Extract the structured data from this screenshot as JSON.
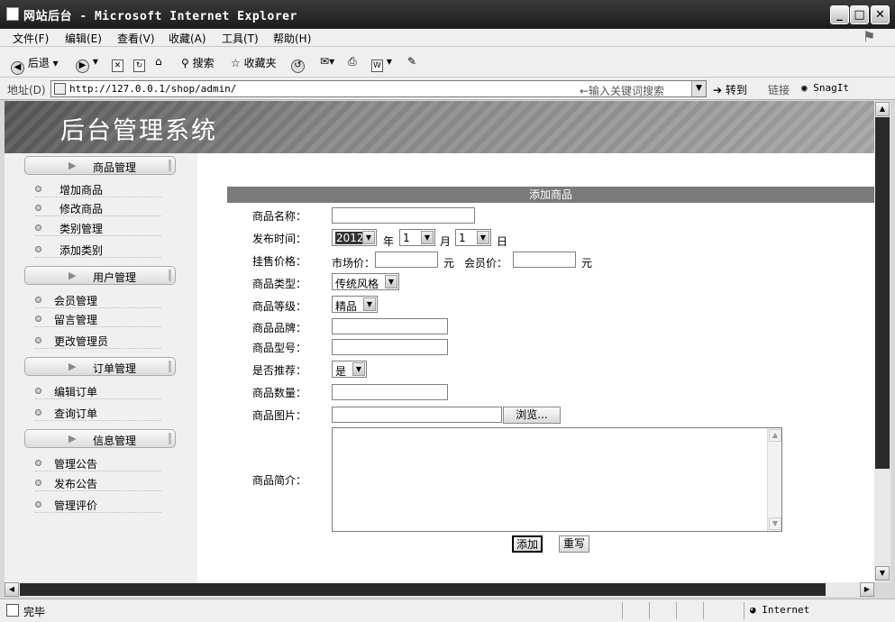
{
  "window": {
    "title": "网站后台 - Microsoft Internet Explorer"
  },
  "menu": [
    "文件(F)",
    "编辑(E)",
    "查看(V)",
    "收藏(A)",
    "工具(T)",
    "帮助(H)"
  ],
  "toolbar": {
    "back": "后退",
    "search": "搜索",
    "favorites": "收藏夹"
  },
  "address": {
    "label": "地址(D)",
    "url": "http://127.0.0.1/shop/admin/",
    "search_hint": "←输入关键词搜索",
    "go": "转到",
    "links": "链接",
    "snagit": "SnagIt"
  },
  "banner": {
    "title": "后台管理系统"
  },
  "sidebar": {
    "sections": [
      {
        "title": "商品管理",
        "items": [
          "增加商品",
          "修改商品",
          "类别管理",
          "添加类别"
        ]
      },
      {
        "title": "用户管理",
        "items": [
          "会员管理",
          "留言管理",
          "更改管理员"
        ]
      },
      {
        "title": "订单管理",
        "items": [
          "编辑订单",
          "查询订单"
        ]
      },
      {
        "title": "信息管理",
        "items": [
          "管理公告",
          "发布公告",
          "管理评价"
        ]
      }
    ]
  },
  "form": {
    "header": "添加商品",
    "labels": {
      "name": "商品名称：",
      "date": "发布时间：",
      "price": "挂售价格：",
      "type": "商品类型：",
      "grade": "商品等级：",
      "brand": "商品品牌：",
      "model": "商品型号：",
      "recommend": "是否推荐：",
      "quantity": "商品数量：",
      "image": "商品图片：",
      "intro": "商品简介："
    },
    "date": {
      "year": "2012",
      "year_unit": "年",
      "month": "1",
      "month_unit": "月",
      "day": "1",
      "day_unit": "日"
    },
    "price": {
      "market_label": "市场价：",
      "unit": "元",
      "member_label": "会员价："
    },
    "type_value": "传统风格",
    "grade_value": "精品",
    "recommend_value": "是",
    "browse_button": "浏览...",
    "submit_button": "添加",
    "reset_button": "重写"
  },
  "status": {
    "text": "完毕",
    "zone": "Internet"
  }
}
